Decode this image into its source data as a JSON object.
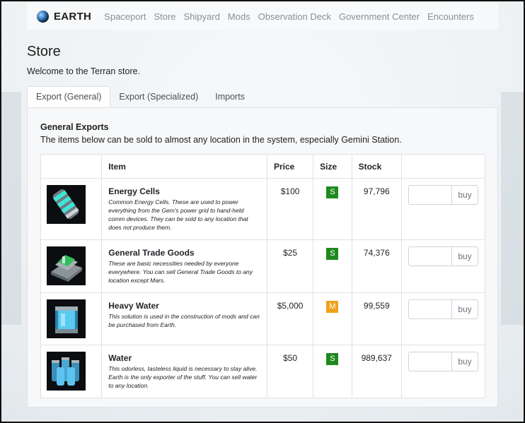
{
  "brand": {
    "name": "EARTH",
    "icon": "globe-icon"
  },
  "nav": {
    "links": [
      "Spaceport",
      "Store",
      "Shipyard",
      "Mods",
      "Observation Deck",
      "Government Center",
      "Encounters"
    ]
  },
  "page": {
    "title": "Store",
    "subtitle": "Welcome to the Terran store."
  },
  "tabs": [
    {
      "label": "Export (General)",
      "active": true
    },
    {
      "label": "Export (Specialized)",
      "active": false
    },
    {
      "label": "Imports",
      "active": false
    }
  ],
  "section": {
    "title": "General Exports",
    "description": "The items below can be sold to almost any location in the system, especially Gemini Station."
  },
  "table": {
    "headers": {
      "image": "",
      "item": "Item",
      "price": "Price",
      "size": "Size",
      "stock": "Stock",
      "action": ""
    },
    "rows": [
      {
        "icon": "energy-cell-icon",
        "name": "Energy Cells",
        "description": "Common Energy Cells. These are used to power everything from the Gem's power grid to hand-held comm devices. They can be sold to any location that does not produce them.",
        "price": "$100",
        "size": "S",
        "size_color": "#1e8a1e",
        "stock": "97,796",
        "qty_value": "",
        "buy_label": "buy"
      },
      {
        "icon": "trade-goods-icon",
        "name": "General Trade Goods",
        "description": "These are basic necessities needed by everyone everywhere. You can sell General Trade Goods to any location except Mars.",
        "price": "$25",
        "size": "S",
        "size_color": "#1e8a1e",
        "stock": "74,376",
        "qty_value": "",
        "buy_label": "buy"
      },
      {
        "icon": "heavy-water-icon",
        "name": "Heavy Water",
        "description": "This solution is used in the construction of mods and can be purchased from Earth.",
        "price": "$5,000",
        "size": "M",
        "size_color": "#f0a21c",
        "stock": "99,559",
        "qty_value": "",
        "buy_label": "buy"
      },
      {
        "icon": "water-icon",
        "name": "Water",
        "description": "This odorless, tasteless liquid is necessary to stay alive. Earth is the only exporter of the stuff. You can sell water to any location.",
        "price": "$50",
        "size": "S",
        "size_color": "#1e8a1e",
        "stock": "989,637",
        "qty_value": "",
        "buy_label": "buy"
      }
    ]
  }
}
